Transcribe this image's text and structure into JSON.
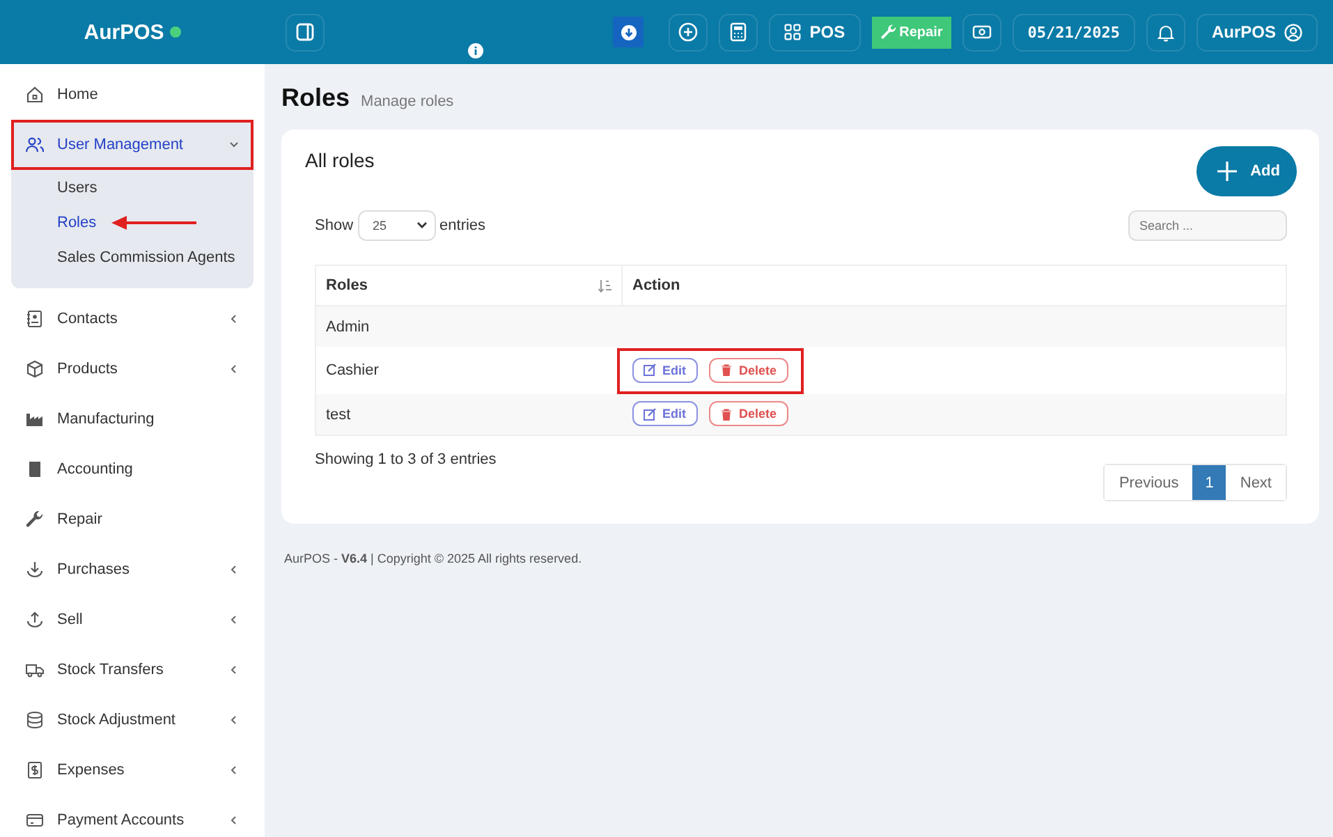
{
  "topbar": {
    "brand": "AurPOS",
    "online": true,
    "pos_label": "POS",
    "repair_label": "Repair",
    "date": "05/21/2025",
    "user": "AurPOS"
  },
  "sidebar": {
    "items": [
      {
        "label": "Home",
        "selected": false,
        "expandable": false,
        "expanded": false,
        "highlighted": false
      },
      {
        "label": "User Management",
        "selected": true,
        "expandable": true,
        "expanded": true,
        "highlighted": true,
        "children": [
          {
            "label": "Users",
            "selected": false
          },
          {
            "label": "Roles",
            "selected": true,
            "arrow": true
          },
          {
            "label": "Sales Commission Agents",
            "selected": false
          }
        ]
      },
      {
        "label": "Contacts",
        "selected": false,
        "expandable": true,
        "expanded": false,
        "highlighted": false
      },
      {
        "label": "Products",
        "selected": false,
        "expandable": true,
        "expanded": false,
        "highlighted": false
      },
      {
        "label": "Manufacturing",
        "selected": false,
        "expandable": false,
        "expanded": false,
        "highlighted": false
      },
      {
        "label": "Accounting",
        "selected": false,
        "expandable": false,
        "expanded": false,
        "highlighted": false
      },
      {
        "label": "Repair",
        "selected": false,
        "expandable": false,
        "expanded": false,
        "highlighted": false
      },
      {
        "label": "Purchases",
        "selected": false,
        "expandable": true,
        "expanded": false,
        "highlighted": false
      },
      {
        "label": "Sell",
        "selected": false,
        "expandable": true,
        "expanded": false,
        "highlighted": false
      },
      {
        "label": "Stock Transfers",
        "selected": false,
        "expandable": true,
        "expanded": false,
        "highlighted": false
      },
      {
        "label": "Stock Adjustment",
        "selected": false,
        "expandable": true,
        "expanded": false,
        "highlighted": false
      },
      {
        "label": "Expenses",
        "selected": false,
        "expandable": true,
        "expanded": false,
        "highlighted": false
      },
      {
        "label": "Payment Accounts",
        "selected": false,
        "expandable": true,
        "expanded": false,
        "highlighted": false
      }
    ]
  },
  "page": {
    "title": "Roles",
    "subtitle": "Manage roles"
  },
  "card": {
    "title": "All roles",
    "add_label": "Add",
    "show_label": "Show",
    "page_size": "25",
    "entries_label": "entries",
    "search": {
      "placeholder": "Search ..."
    }
  },
  "table": {
    "columns": [
      "Roles",
      "Action"
    ],
    "rows": [
      {
        "role": "Admin",
        "actions": [],
        "highlighted": false
      },
      {
        "role": "Cashier",
        "actions": [
          "Edit",
          "Delete"
        ],
        "highlighted": true
      },
      {
        "role": "test",
        "actions": [
          "Edit",
          "Delete"
        ],
        "highlighted": false
      }
    ]
  },
  "info": "Showing 1 to 3 of 3 entries",
  "pagination": [
    {
      "label": "Previous",
      "selected": false
    },
    {
      "label": "1",
      "selected": true
    },
    {
      "label": "Next",
      "selected": false
    }
  ],
  "footer": {
    "text": "AurPOS - **V6.4** | Copyright © 2025 All rights reserved."
  }
}
